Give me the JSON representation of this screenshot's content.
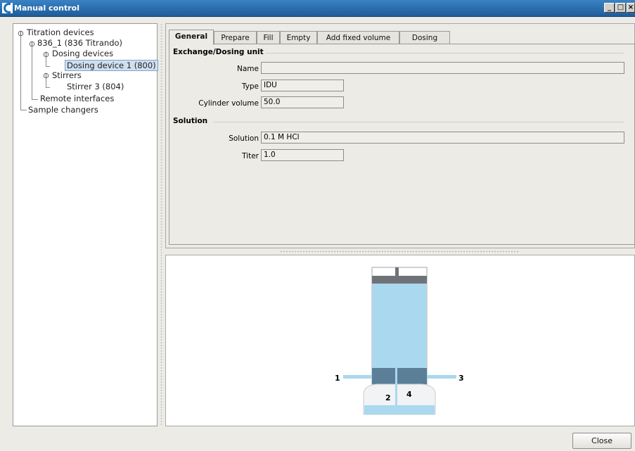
{
  "window": {
    "title": "Manual control",
    "buttons": {
      "minimize": "_",
      "maximize": "□",
      "close": "×"
    }
  },
  "tree": {
    "items": [
      {
        "label": "Titration devices"
      },
      {
        "label": "836_1 (836 Titrando)"
      },
      {
        "label": "Dosing devices"
      },
      {
        "label": "Dosing device 1 (800)",
        "selected": true
      },
      {
        "label": "Stirrers"
      },
      {
        "label": "Stirrer 3 (804)"
      },
      {
        "label": "Remote interfaces"
      },
      {
        "label": "Sample changers"
      }
    ]
  },
  "tabs": [
    "General",
    "Prepare",
    "Fill",
    "Empty",
    "Add fixed volume",
    "Dosing"
  ],
  "active_tab": "General",
  "general": {
    "section_exchange": "Exchange/Dosing unit",
    "name_label": "Name",
    "name_value": "",
    "type_label": "Type",
    "type_value": "IDU",
    "cylinder_label": "Cylinder volume",
    "cylinder_value": "50.0",
    "section_solution": "Solution",
    "solution_label": "Solution",
    "solution_value": "0.1 M HCl",
    "titer_label": "Titer",
    "titer_value": "1.0"
  },
  "diagram": {
    "port_labels": [
      "1",
      "2",
      "3",
      "4"
    ],
    "colors": {
      "liquid": "#a9d8ef",
      "piston": "#6f7378",
      "valve": "#5b7f98"
    }
  },
  "footer": {
    "close_label": "Close"
  }
}
